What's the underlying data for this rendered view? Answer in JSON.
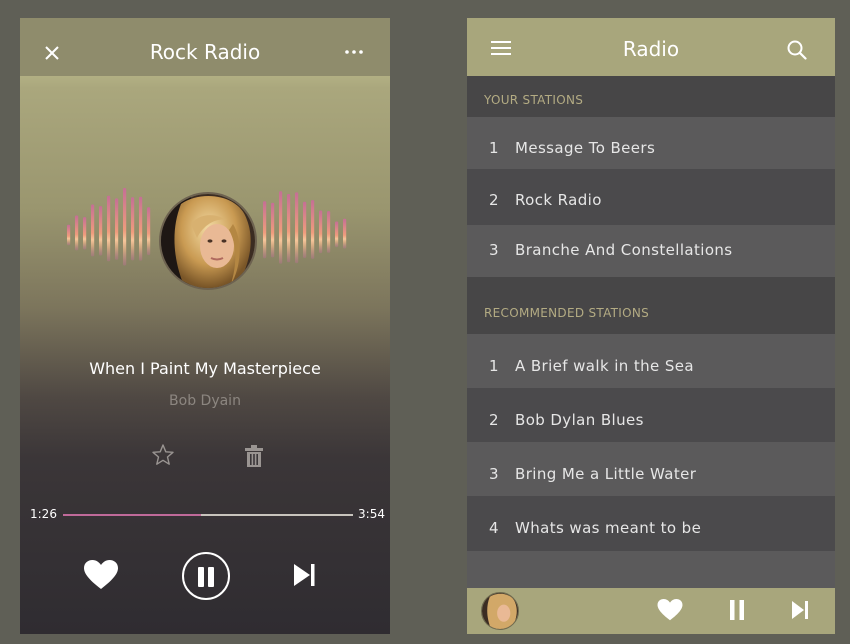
{
  "player": {
    "title": "Rock Radio",
    "song_title": "When I Paint My Masterpiece",
    "artist": "Bob Dyain",
    "current_time": "1:26",
    "total_time": "3:54",
    "progress": 0.475,
    "icons": {
      "close": "close-icon",
      "more": "more-icon",
      "favorite": "star-icon",
      "delete": "trash-icon",
      "like": "heart-icon",
      "play_pause": "pause-icon",
      "next": "skip-next-icon"
    }
  },
  "stations": {
    "title": "Radio",
    "your_label": "YOUR STATIONS",
    "your": [
      {
        "num": "1",
        "name": "Message To Beers"
      },
      {
        "num": "2",
        "name": "Rock Radio"
      },
      {
        "num": "3",
        "name": "Branche And Constellations"
      }
    ],
    "recommended_label": "RECOMMENDED STATIONS",
    "recommended": [
      {
        "num": "1",
        "name": "A Brief walk in the Sea"
      },
      {
        "num": "2",
        "name": "Bob Dylan Blues"
      },
      {
        "num": "3",
        "name": "Bring Me a Little Water"
      },
      {
        "num": "4",
        "name": "Whats was meant to be"
      }
    ],
    "icons": {
      "menu": "hamburger-menu-icon",
      "search": "search-icon"
    }
  },
  "colors": {
    "accent_olive": "#a8a67c",
    "progress_pink": "#c06a9a",
    "section_label": "#b3ab83"
  }
}
